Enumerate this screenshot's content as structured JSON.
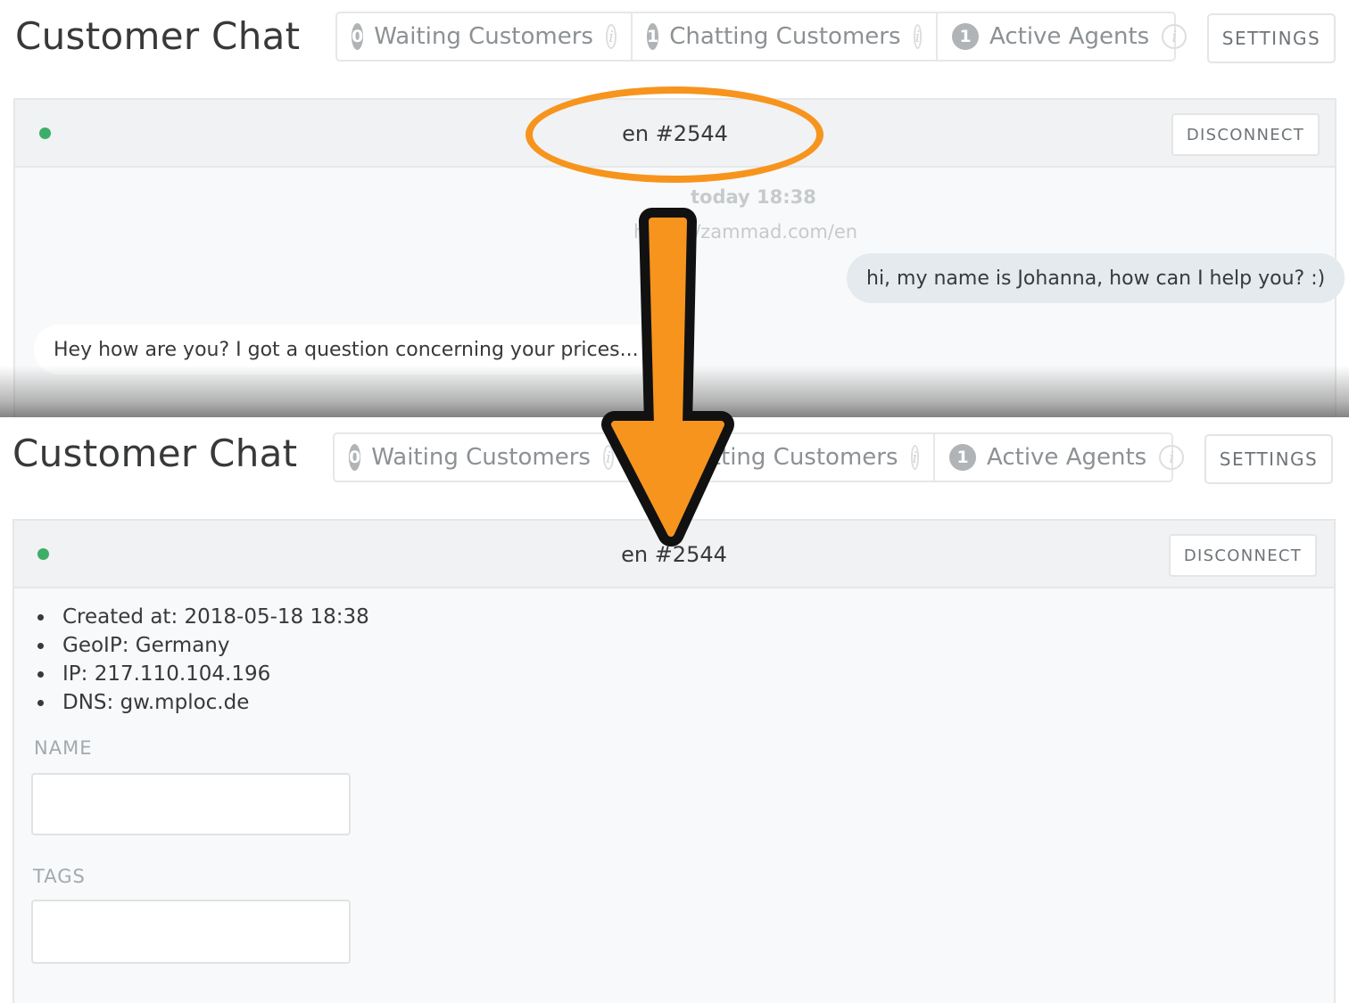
{
  "app_title": "Customer Chat",
  "counters": [
    {
      "count": "0",
      "label": "Waiting Customers",
      "info": "i"
    },
    {
      "count": "1",
      "label": "Chatting Customers",
      "info": "i"
    },
    {
      "count": "1",
      "label": "Active Agents",
      "info": "i"
    }
  ],
  "settings_label": "SETTINGS",
  "chat": {
    "title": "en #2544",
    "disconnect_label": "DISCONNECT",
    "status_color": "#3dae68",
    "timestamp": "today 18:38",
    "url": "https://zammad.com/en",
    "messages": [
      {
        "from": "agent",
        "text": "hi, my name is Johanna, how can I help you? :)"
      },
      {
        "from": "customer",
        "text": "Hey how are you? I got a question concerning your prices..."
      }
    ]
  },
  "details": {
    "created_at": "Created at: 2018-05-18 18:38",
    "geoip": "GeoIP: Germany",
    "ip": "IP: 217.110.104.196",
    "dns": "DNS: gw.mploc.de"
  },
  "form": {
    "name_label": "NAME",
    "name_value": "",
    "tags_label": "TAGS",
    "tags_value": ""
  },
  "annotation_color": "#f7941d"
}
